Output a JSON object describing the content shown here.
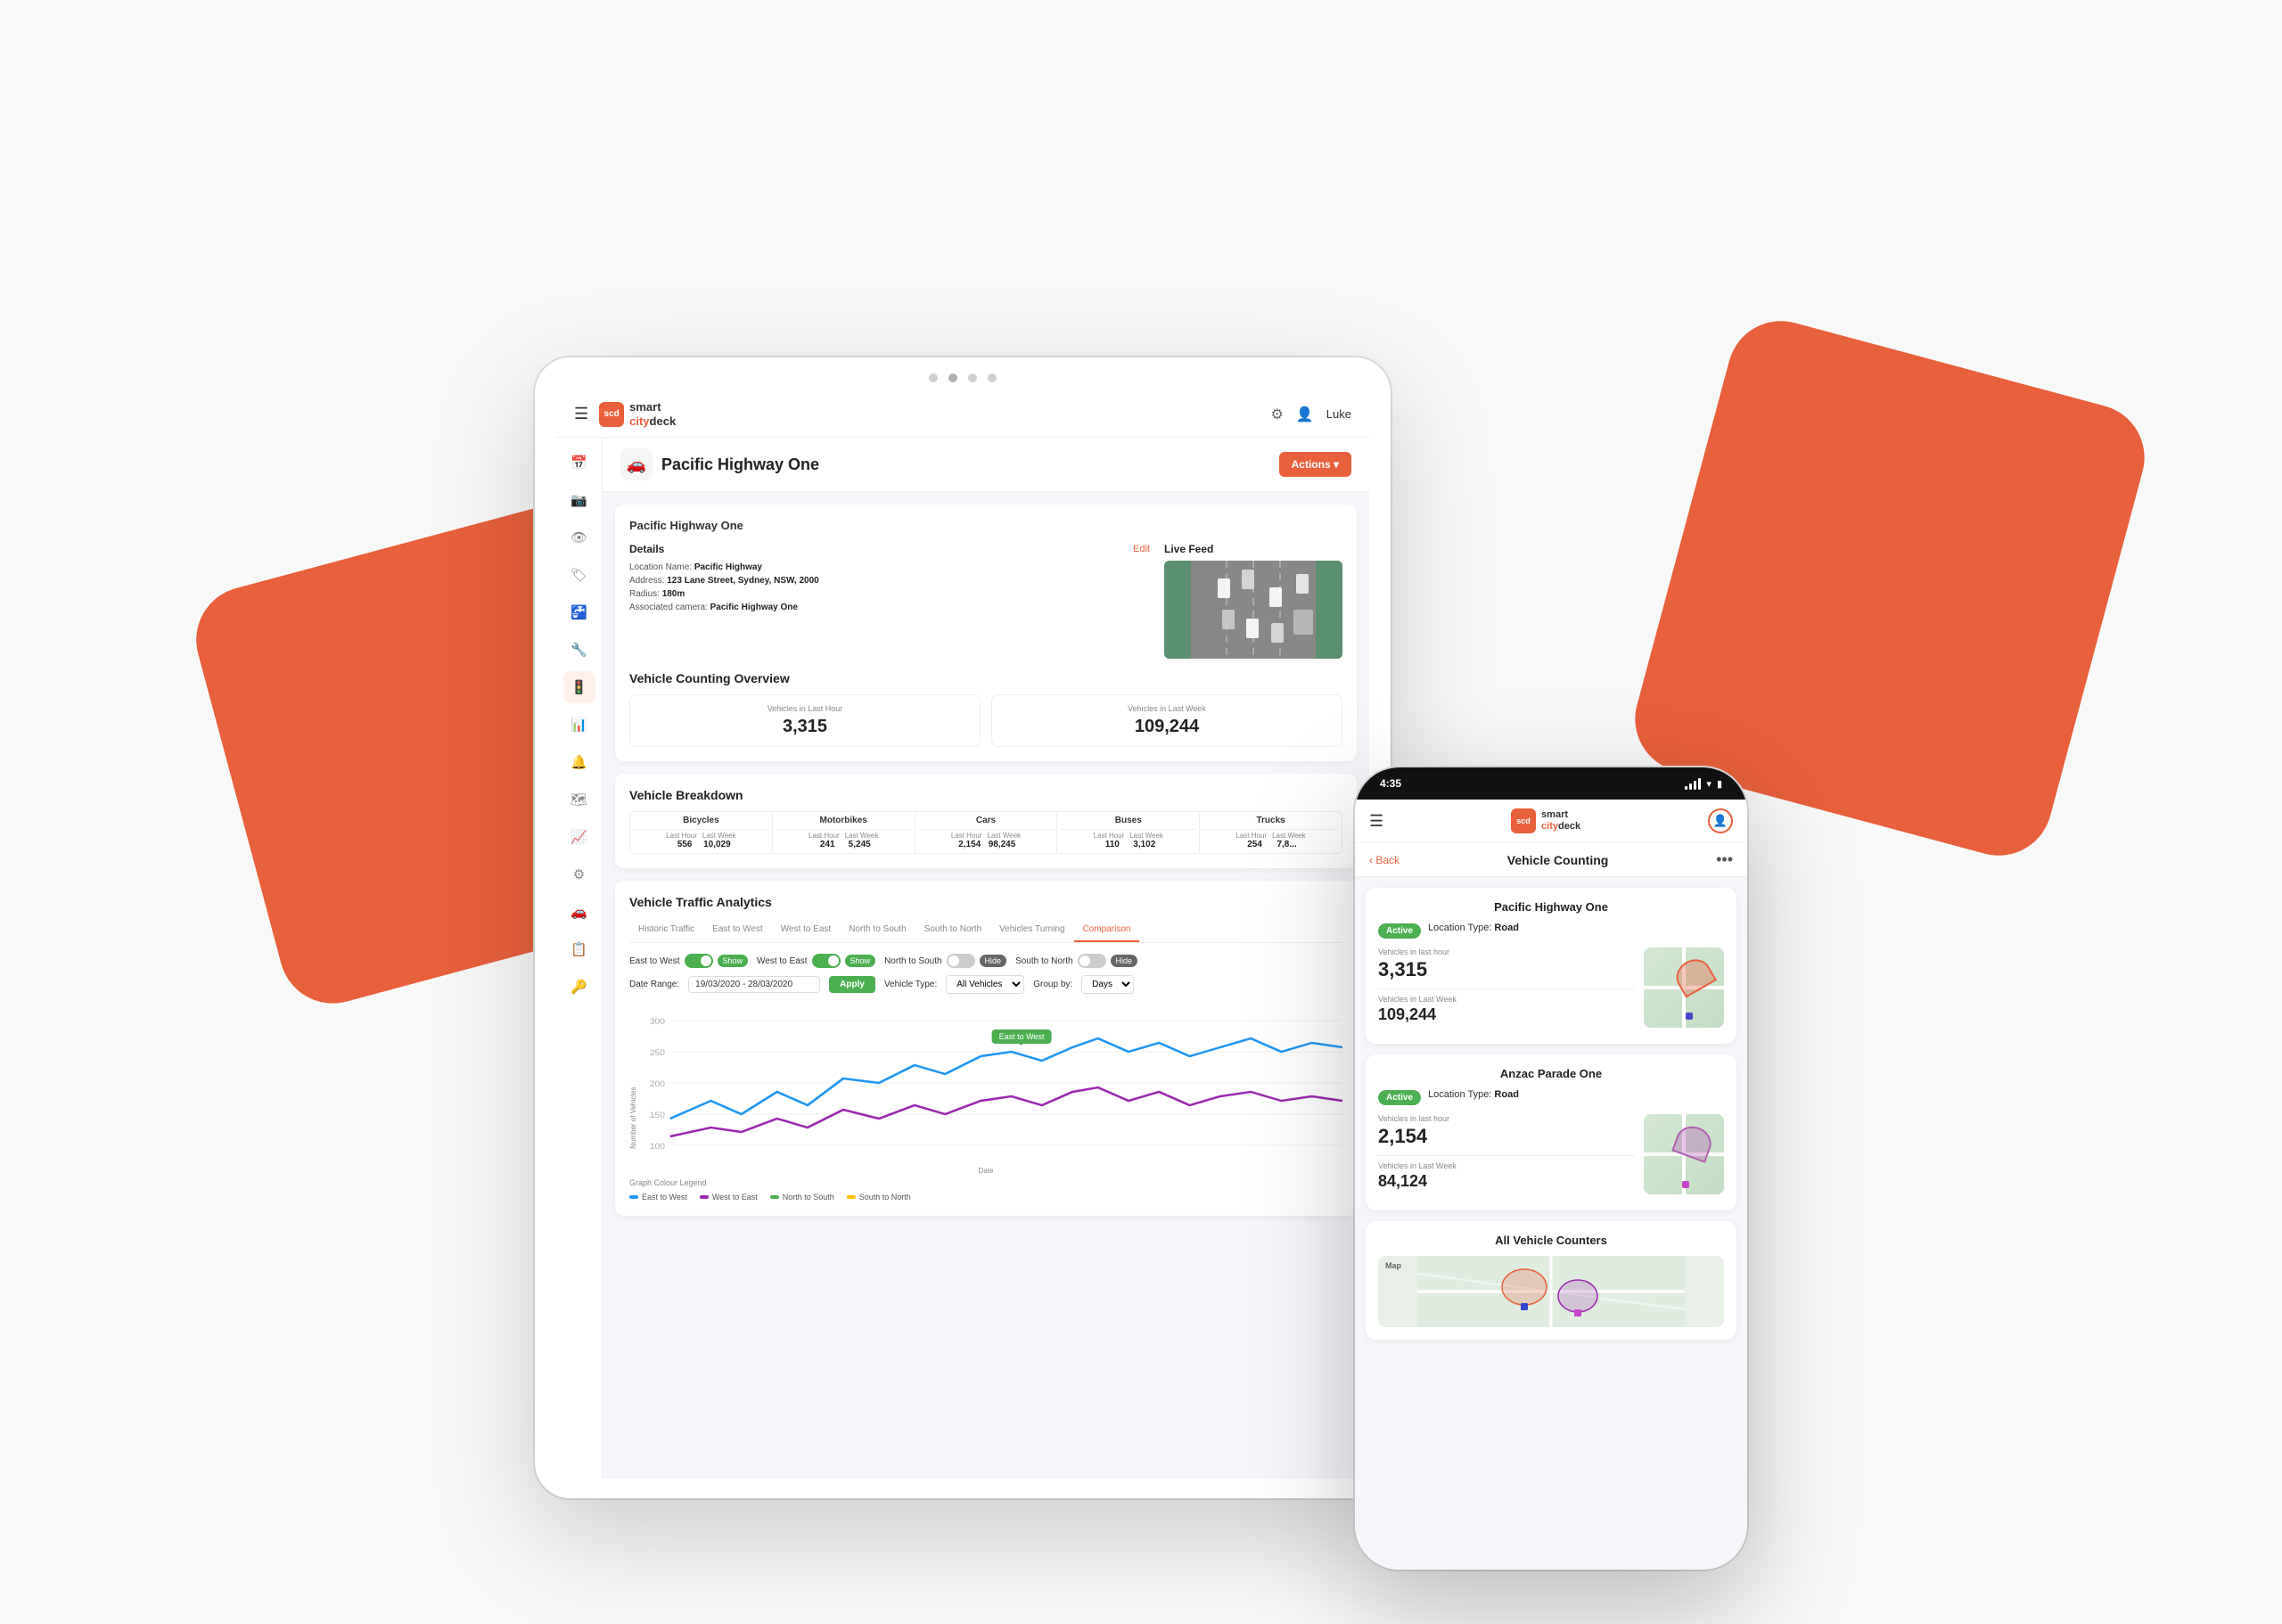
{
  "bg": {
    "shape_left_visible": true,
    "shape_right_visible": true
  },
  "tablet": {
    "dots": [
      "",
      "",
      ""
    ],
    "topbar": {
      "brand_line1": "smart",
      "brand_line2": "citydeck",
      "settings_icon": "⚙",
      "user_icon": "👤",
      "user_name": "Luke"
    },
    "sidebar_icons": [
      "☰",
      "📅",
      "📷",
      "👁",
      "🏷",
      "🚰",
      "🔧",
      "🚦",
      "📊",
      "🔔",
      "🗺",
      "📈",
      "⚙",
      "🚗",
      "📋",
      "🔑"
    ],
    "page_header": {
      "icon": "🚗",
      "title": "Pacific Highway One",
      "actions_label": "Actions ▾"
    },
    "card": {
      "location_name": "Pacific Highway One",
      "details": {
        "heading": "Details",
        "edit_label": "Edit",
        "location_name_label": "Location Name:",
        "location_name_value": "Pacific Highway",
        "address_label": "Address:",
        "address_value": "123 Lane Street, Sydney, NSW, 2000",
        "radius_label": "Radius:",
        "radius_value": "180m",
        "camera_label": "Associated camera:",
        "camera_value": "Pacific Highway One"
      },
      "live_feed": {
        "label": "Live Feed"
      },
      "vehicle_counting_overview": {
        "heading": "Vehicle Counting Overview",
        "last_hour_label": "Vehicles in Last Hour",
        "last_hour_value": "3,315",
        "last_week_label": "Vehicles in Last Week",
        "last_week_value": "109,244"
      },
      "breakdown": {
        "heading": "Vehicle Breakdown",
        "categories": [
          {
            "name": "Bicycles",
            "last_hour_label": "Last Hour",
            "last_week_label": "Last Week",
            "last_hour": "556",
            "last_week": "10,029"
          },
          {
            "name": "Motorbikes",
            "last_hour_label": "Last Hour",
            "last_week_label": "Last Week",
            "last_hour": "241",
            "last_week": "5,245"
          },
          {
            "name": "Cars",
            "last_hour_label": "Last Hour",
            "last_week_label": "Last Week",
            "last_hour": "2,154",
            "last_week": "98,245"
          },
          {
            "name": "Buses",
            "last_hour_label": "Last Hour",
            "last_week_label": "Last Week",
            "last_hour": "110",
            "last_week": "3,102"
          },
          {
            "name": "Trucks",
            "last_hour_label": "Last Hour",
            "last_week_label": "Last Week",
            "last_hour": "254",
            "last_week": "7,8..."
          }
        ]
      },
      "analytics": {
        "heading": "Vehicle Traffic Analytics",
        "tabs": [
          "Historic Traffic",
          "East to West",
          "West to East",
          "North to South",
          "South to North",
          "Vehicles Turning",
          "Comparison"
        ],
        "active_tab": "Comparison",
        "filters": [
          {
            "label": "East to West",
            "state": "show"
          },
          {
            "label": "West to East",
            "state": "show"
          },
          {
            "label": "North to South",
            "state": "hide"
          },
          {
            "label": "South to North",
            "state": "hide"
          }
        ],
        "date_range_label": "Date Range:",
        "date_range_value": "19/03/2020 - 28/03/2020",
        "apply_label": "Apply",
        "vehicle_type_label": "Vehicle Type:",
        "vehicle_type_value": "All Vehicles",
        "group_by_label": "Group by:",
        "group_by_value": "Days",
        "chart_y_label": "Number of Vehicles",
        "chart_x_label": "Date",
        "tooltip_label": "East to West",
        "legend": [
          {
            "label": "East to West",
            "color": "#2196f3"
          },
          {
            "label": "West to East",
            "color": "#9c27b0"
          },
          {
            "label": "North to South",
            "color": "#4caf50"
          },
          {
            "label": "South to North",
            "color": "#ffc107"
          }
        ]
      }
    }
  },
  "mobile": {
    "time": "4:35",
    "topbar": {
      "brand_line1": "smart",
      "brand_line2": "citydeck",
      "brand_line3": "deck"
    },
    "back_label": "‹ Back",
    "page_title": "Vehicle Counting",
    "more_icon": "•••",
    "cards": [
      {
        "title": "Pacific Highway One",
        "active_label": "Active",
        "location_type_label": "Location Type:",
        "location_type_value": "Road",
        "vehicles_last_hour_label": "Vehicles in last hour",
        "vehicles_last_hour": "3,315",
        "vehicles_last_week_label": "Vehicles in Last Week",
        "vehicles_last_week": "109,244",
        "map_sector_color": "#e8603c",
        "map_dot_color": "#3344cc"
      },
      {
        "title": "Anzac Parade One",
        "active_label": "Active",
        "location_type_label": "Location Type:",
        "location_type_value": "Road",
        "vehicles_last_hour_label": "Vehicles in last hour",
        "vehicles_last_hour": "2,154",
        "vehicles_last_week_label": "Vehicles in Last Week",
        "vehicles_last_week": "84,124",
        "map_sector_color": "#9c27b0",
        "map_dot_color": "#cc44cc"
      }
    ],
    "all_counters": {
      "title": "All Vehicle Counters",
      "map_label": "Map"
    }
  }
}
